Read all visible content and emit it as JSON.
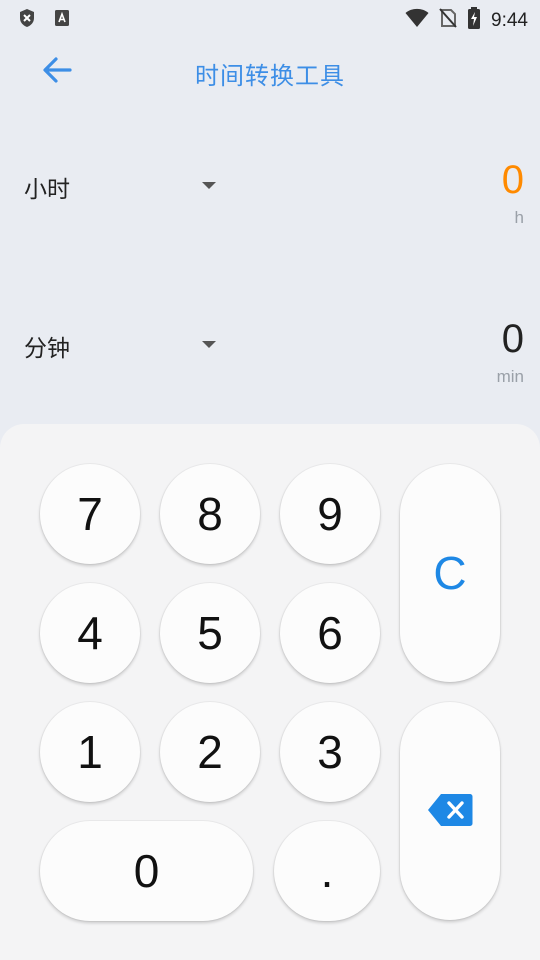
{
  "status_bar": {
    "time": "9:44",
    "left_icons": [
      "shield-icon",
      "keyboard-a-icon"
    ],
    "right_icons": [
      "wifi-icon",
      "no-sim-icon",
      "battery-charging-icon"
    ]
  },
  "header": {
    "title": "时间转换工具",
    "back_icon": "arrow-left-icon"
  },
  "units": [
    {
      "name": "小时",
      "value": "0",
      "symbol": "h",
      "active": true
    },
    {
      "name": "分钟",
      "value": "0",
      "symbol": "min",
      "active": false
    }
  ],
  "keypad": {
    "keys": [
      "7",
      "8",
      "9",
      "4",
      "5",
      "6",
      "1",
      "2",
      "3",
      "0",
      "."
    ],
    "clear_label": "C",
    "backspace_icon": "backspace-icon"
  },
  "colors": {
    "accent": "#3D8EE6",
    "active_value": "#FF8A00",
    "clear": "#1E88E5",
    "background": "#E9ECF2",
    "keypad_bg": "#F4F4F5"
  }
}
